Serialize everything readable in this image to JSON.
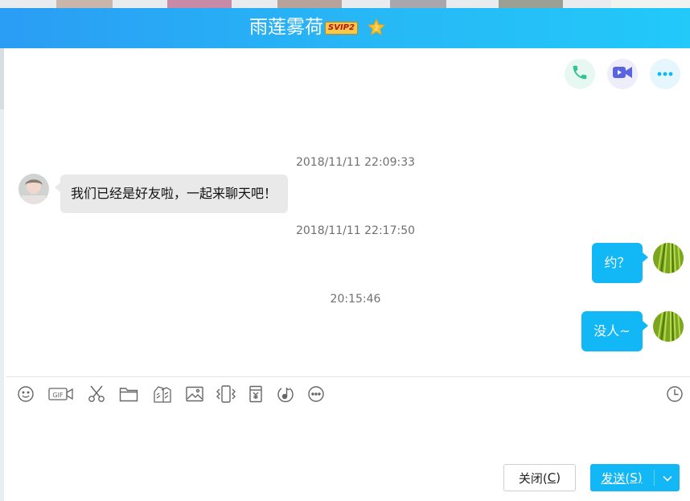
{
  "window": {
    "title": "雨莲雾荷",
    "vip_badge": "SVIP2",
    "colors": {
      "titlebar_start": "#2a9df4",
      "titlebar_end": "#22c9f9",
      "accent": "#12b7f5"
    }
  },
  "header_actions": [
    {
      "name": "voice-call",
      "icon": "phone-icon"
    },
    {
      "name": "video-call",
      "icon": "video-camera-icon"
    },
    {
      "name": "more",
      "icon": "more-dots-icon"
    }
  ],
  "messages": [
    {
      "timestamp": "2018/11/11 22:09:33",
      "direction": "in",
      "text": "我们已经是好友啦，一起来聊天吧！"
    },
    {
      "timestamp": "2018/11/11 22:17:50",
      "direction": "out",
      "text": "约？"
    },
    {
      "timestamp": "20:15:46",
      "direction": "out",
      "text": "没人~"
    }
  ],
  "toolbar": {
    "tools": [
      "emoji-icon",
      "gif-icon",
      "screenshot-scissors-icon",
      "folder-icon",
      "doodle-icon",
      "image-icon",
      "shake-icon",
      "red-packet-icon",
      "music-icon",
      "more-icon"
    ],
    "gif_label": "GIF",
    "history_icon": "clock-icon"
  },
  "footer": {
    "close_label": "关闭(",
    "close_key": "C",
    "close_end": ")",
    "send_label": "发送(",
    "send_key": "S",
    "send_end": ")"
  }
}
